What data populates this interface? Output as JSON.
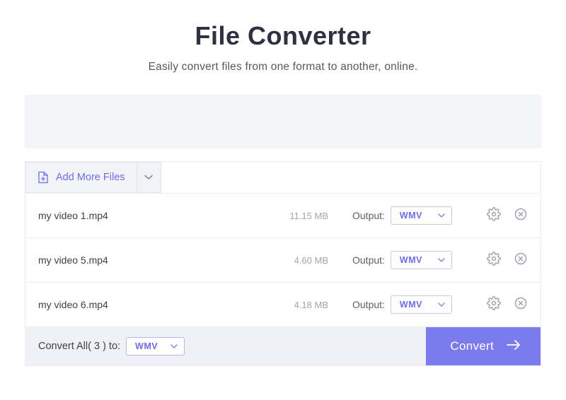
{
  "header": {
    "title": "File Converter",
    "subtitle": "Easily convert files from one format to another, online."
  },
  "toolbar": {
    "add_more_label": "Add More Files"
  },
  "files": [
    {
      "name": "my video 1.mp4",
      "size": "11.15 MB",
      "output_label": "Output:",
      "format": "WMV"
    },
    {
      "name": "my video 5.mp4",
      "size": "4.60 MB",
      "output_label": "Output:",
      "format": "WMV"
    },
    {
      "name": "my video 6.mp4",
      "size": "4.18 MB",
      "output_label": "Output:",
      "format": "WMV"
    }
  ],
  "footer": {
    "convert_all_label": "Convert All( 3 ) to:",
    "format": "WMV",
    "convert_button": "Convert"
  },
  "colors": {
    "accent": "#7b7bee"
  }
}
